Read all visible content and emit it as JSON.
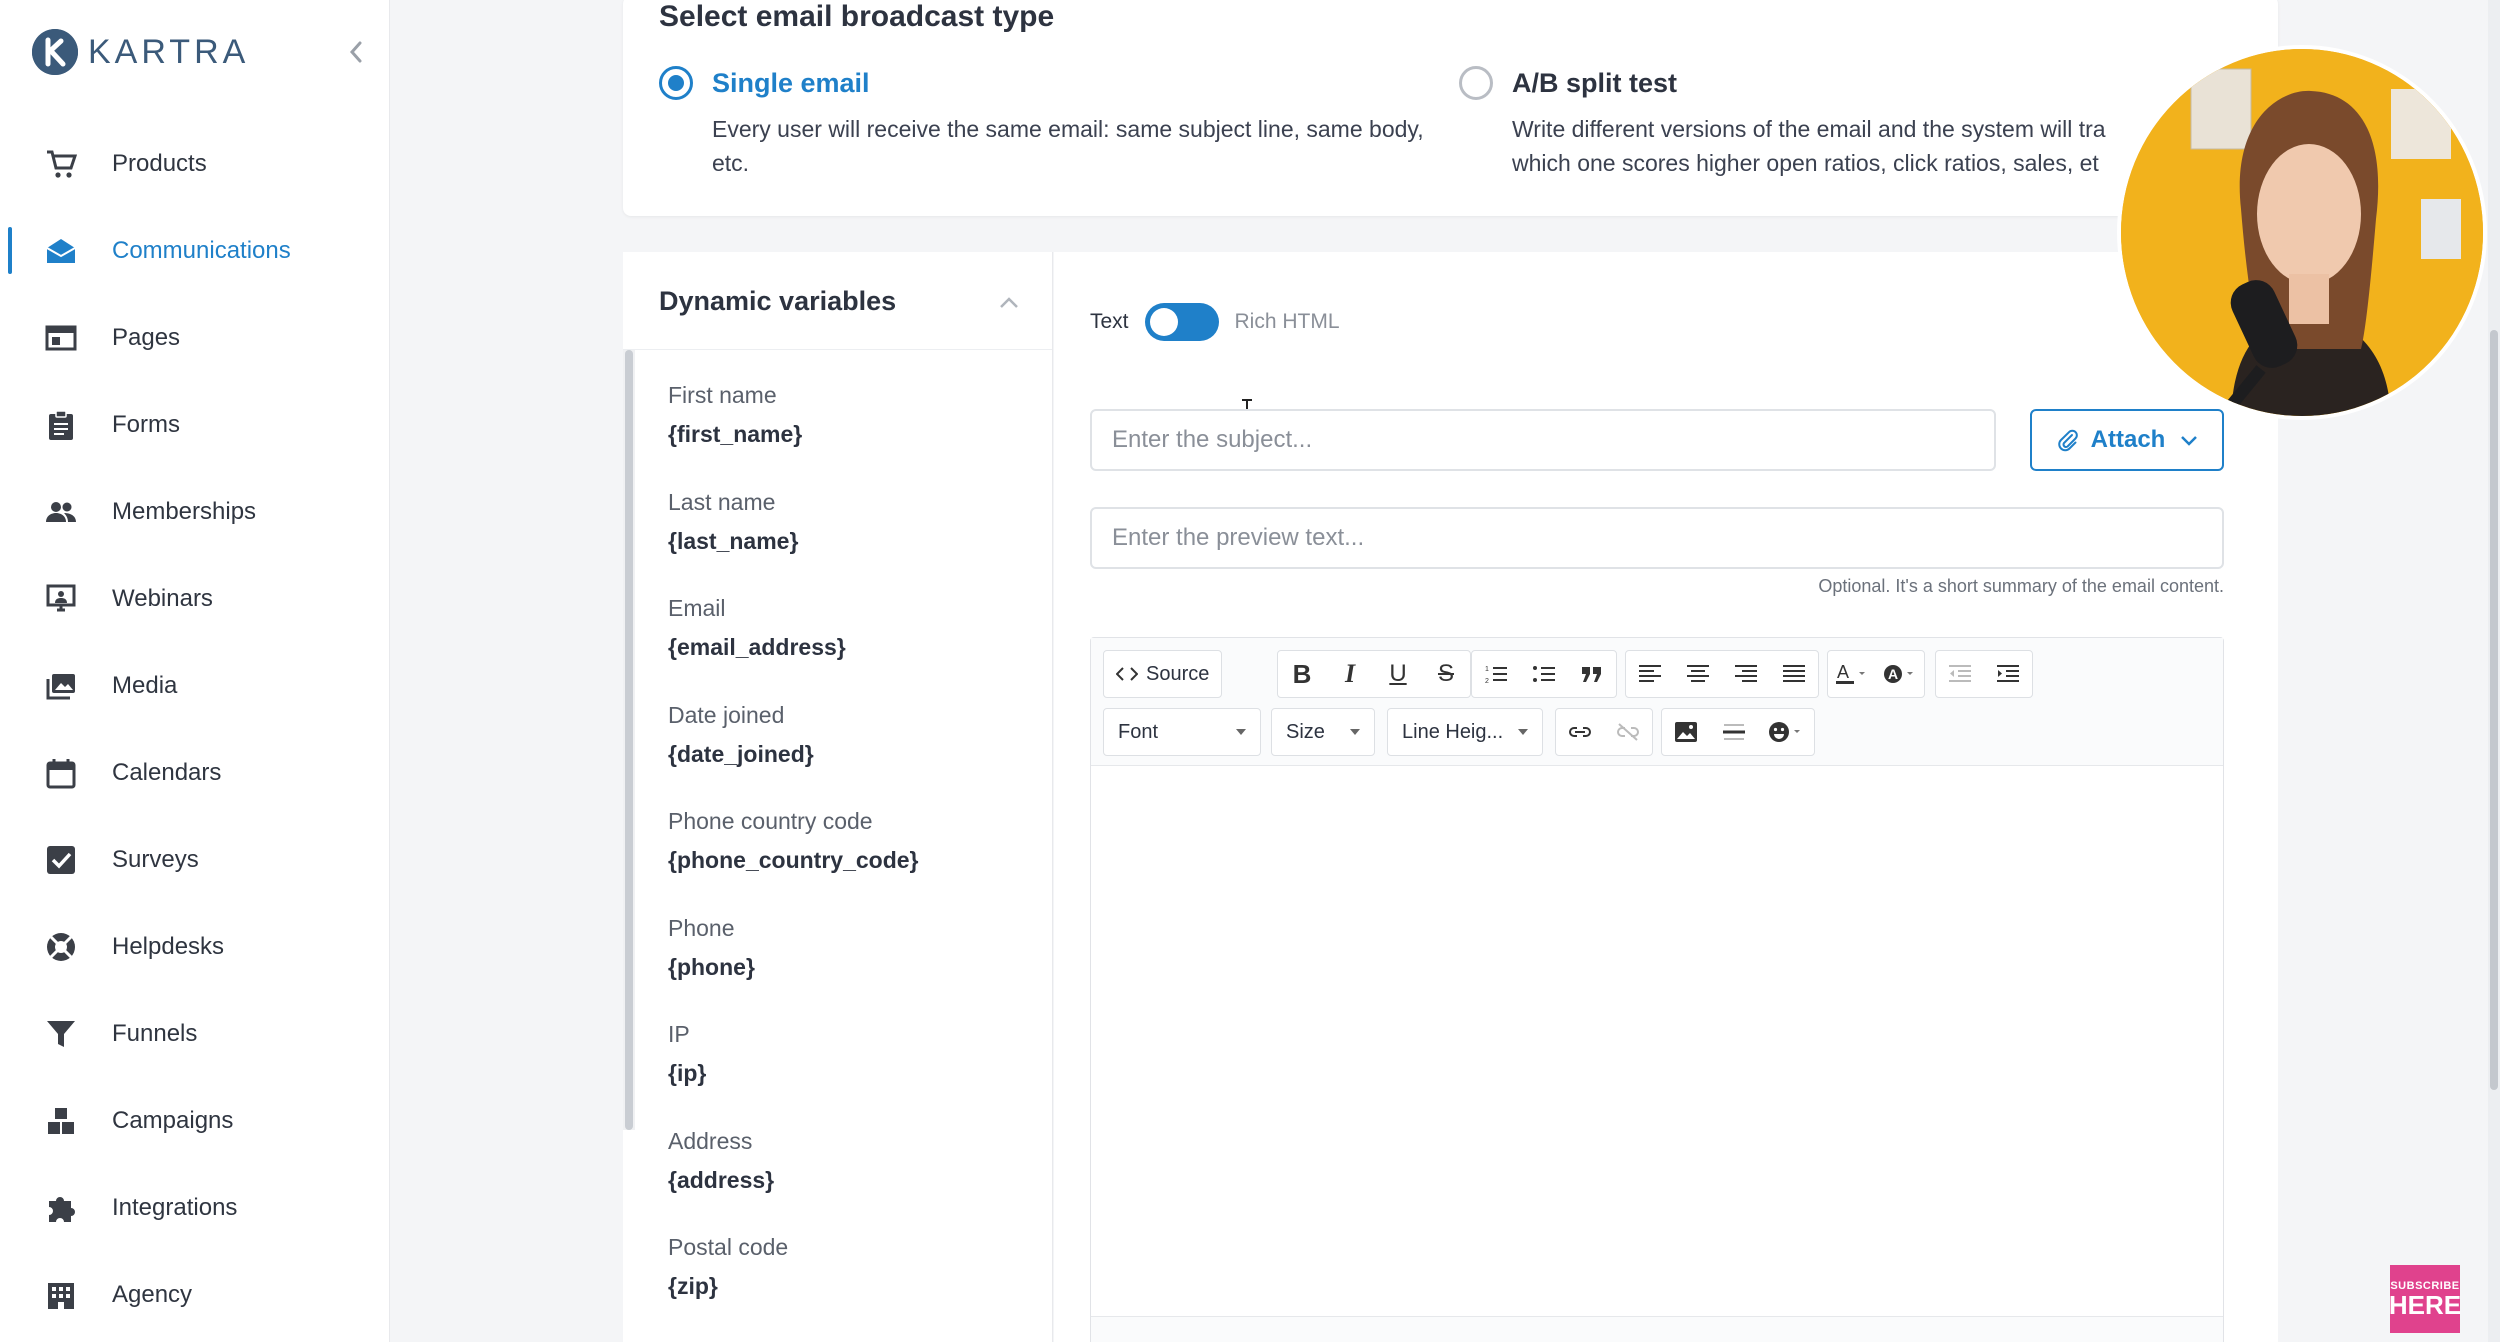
{
  "brand": {
    "name": "KARTRA",
    "accent": "#1f80c9",
    "logo_color": "#3b5a7a"
  },
  "sidebar": {
    "items": [
      {
        "label": "Products",
        "icon": "cart-icon"
      },
      {
        "label": "Communications",
        "icon": "envelope-icon",
        "active": true
      },
      {
        "label": "Pages",
        "icon": "browser-window-icon"
      },
      {
        "label": "Forms",
        "icon": "clipboard-icon"
      },
      {
        "label": "Memberships",
        "icon": "people-icon"
      },
      {
        "label": "Webinars",
        "icon": "presentation-icon"
      },
      {
        "label": "Media",
        "icon": "media-gallery-icon"
      },
      {
        "label": "Calendars",
        "icon": "calendar-icon"
      },
      {
        "label": "Surveys",
        "icon": "checkbox-icon"
      },
      {
        "label": "Helpdesks",
        "icon": "lifebuoy-icon"
      },
      {
        "label": "Funnels",
        "icon": "funnel-icon"
      },
      {
        "label": "Campaigns",
        "icon": "blocks-icon"
      },
      {
        "label": "Integrations",
        "icon": "puzzle-icon"
      },
      {
        "label": "Agency",
        "icon": "building-icon"
      }
    ]
  },
  "broadcast_type": {
    "title": "Select email broadcast type",
    "options": [
      {
        "title": "Single email",
        "desc": "Every user will receive the same email: same subject line, same body, etc.",
        "selected": true
      },
      {
        "title": "A/B split test",
        "desc": "Write different versions of the email and the system will tra which one scores higher open ratios, click ratios, sales, et",
        "selected": false
      }
    ]
  },
  "dynamic_variables": {
    "title": "Dynamic variables",
    "items": [
      {
        "label": "First name",
        "code": "{first_name}"
      },
      {
        "label": "Last name",
        "code": "{last_name}"
      },
      {
        "label": "Email",
        "code": "{email_address}"
      },
      {
        "label": "Date joined",
        "code": "{date_joined}"
      },
      {
        "label": "Phone country code",
        "code": "{phone_country_code}"
      },
      {
        "label": "Phone",
        "code": "{phone}"
      },
      {
        "label": "IP",
        "code": "{ip}"
      },
      {
        "label": "Address",
        "code": "{address}"
      },
      {
        "label": "Postal code",
        "code": "{zip}"
      }
    ]
  },
  "editor": {
    "mode_left": "Text",
    "mode_right": "Rich HTML",
    "subject_placeholder": "Enter the subject...",
    "attach_label": "Attach",
    "preview_placeholder": "Enter the preview text...",
    "preview_hint": "Optional. It's a short summary of the email content.",
    "toolbar": {
      "source_label": "Source",
      "font_label": "Font",
      "size_label": "Size",
      "line_height_label": "Line Heig..."
    }
  },
  "subscribe_badge": {
    "line1": "SUBSCRIBE",
    "line2": "HERE"
  }
}
